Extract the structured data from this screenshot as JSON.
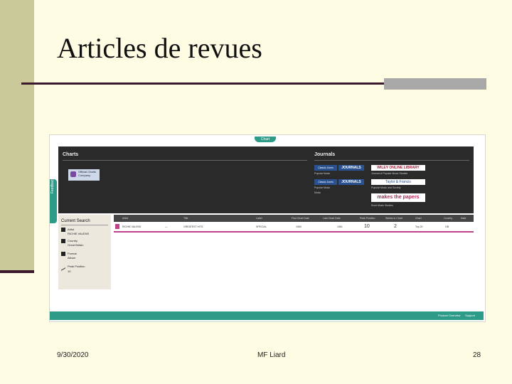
{
  "slide": {
    "title": "Articles de revues",
    "date": "9/30/2020",
    "author": "MF Liard",
    "page": "28"
  },
  "screenshot": {
    "chart_button": "Chart",
    "side_tab": "Feedback",
    "charts_heading": "Charts",
    "charts_logo": "Official Charts Company",
    "journals_heading": "Journals",
    "journal_buttons": [
      "Classic Jones",
      "Classic Jones"
    ],
    "journal_logos": [
      "JOURNALS",
      "JOURNALS"
    ],
    "journal_brand": "WILEY ONLINE LIBRARY",
    "journal_brand2": "Taylor & Francis",
    "journal_brand3": "makes the papers",
    "journal_links": [
      "Popular Music",
      "Journal of Popular Music Studies",
      "Popular Music",
      "Popular Music and Society",
      "Music",
      "Rock Music Studies"
    ],
    "current_search_heading": "Current Search",
    "search_items": [
      {
        "label": "Artist",
        "value": "RICHIE VALENS"
      },
      {
        "label": "Country",
        "value": "Great Britain"
      },
      {
        "label": "Format",
        "value": "Album"
      },
      {
        "label": "Peak Position",
        "value": "10"
      }
    ],
    "table_headers": [
      "Artist",
      "Title",
      "Label",
      "First Chart Date",
      "Last Chart Date",
      "Peak Position",
      "Weeks in Chart",
      "Chart",
      "Country",
      "Date"
    ],
    "table_row": [
      "RICHIE VALENS",
      "—",
      "GREATEST HITS",
      "SPECIAL",
      "1960",
      "1961",
      "10",
      "2",
      "Top 20",
      "GB"
    ],
    "footer_links": [
      "Product Overview",
      "Support"
    ]
  }
}
